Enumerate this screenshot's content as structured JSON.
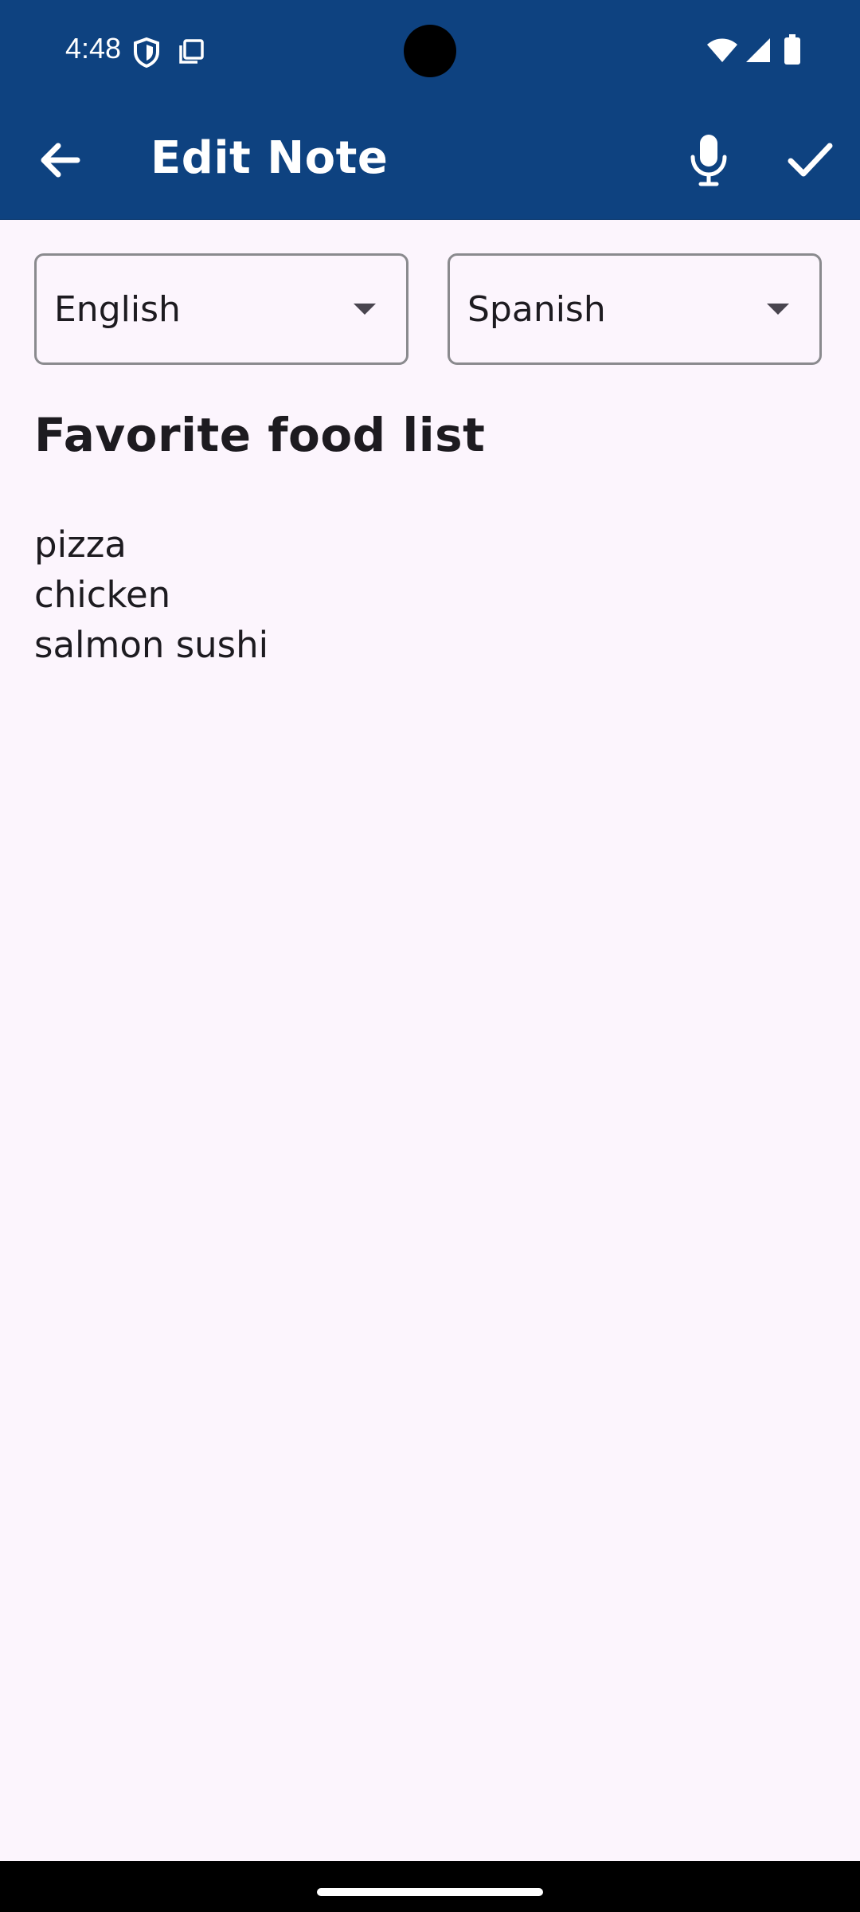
{
  "status_bar": {
    "time": "4:48",
    "left_icons": [
      "shield-icon",
      "screenshot-icon"
    ],
    "right_icons": [
      "wifi-icon",
      "cellular-signal-icon",
      "battery-icon"
    ]
  },
  "app_bar": {
    "title": "Edit Note",
    "back_icon": "arrow-back-icon",
    "mic_icon": "mic-icon",
    "save_icon": "check-icon"
  },
  "languages": {
    "source": {
      "selected": "English",
      "arrow_icon": "dropdown-arrow-icon"
    },
    "target": {
      "selected": "Spanish",
      "arrow_icon": "dropdown-arrow-icon"
    }
  },
  "note": {
    "title": "Favorite food list",
    "body": "pizza\nchicken\nsalmon sushi"
  },
  "colors": {
    "primary": "#0E4280",
    "background": "#FCF5FD",
    "text": "#1D1B20",
    "outline": "#8A8A8E"
  }
}
